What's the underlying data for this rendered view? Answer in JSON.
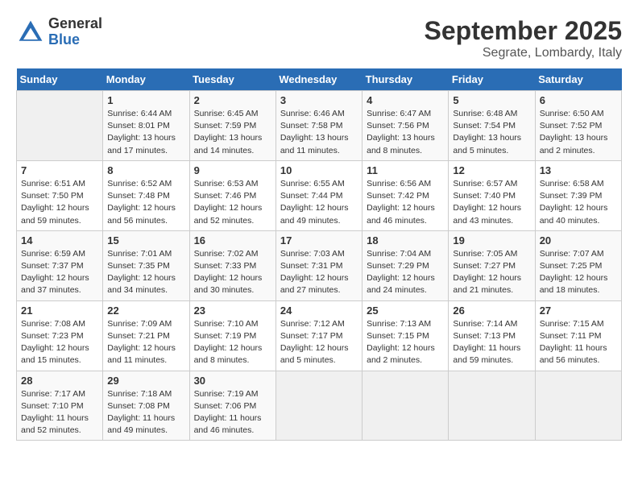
{
  "header": {
    "logo_general": "General",
    "logo_blue": "Blue",
    "title": "September 2025",
    "subtitle": "Segrate, Lombardy, Italy"
  },
  "days_of_week": [
    "Sunday",
    "Monday",
    "Tuesday",
    "Wednesday",
    "Thursday",
    "Friday",
    "Saturday"
  ],
  "weeks": [
    [
      {
        "day": "",
        "info": ""
      },
      {
        "day": "1",
        "info": "Sunrise: 6:44 AM\nSunset: 8:01 PM\nDaylight: 13 hours\nand 17 minutes."
      },
      {
        "day": "2",
        "info": "Sunrise: 6:45 AM\nSunset: 7:59 PM\nDaylight: 13 hours\nand 14 minutes."
      },
      {
        "day": "3",
        "info": "Sunrise: 6:46 AM\nSunset: 7:58 PM\nDaylight: 13 hours\nand 11 minutes."
      },
      {
        "day": "4",
        "info": "Sunrise: 6:47 AM\nSunset: 7:56 PM\nDaylight: 13 hours\nand 8 minutes."
      },
      {
        "day": "5",
        "info": "Sunrise: 6:48 AM\nSunset: 7:54 PM\nDaylight: 13 hours\nand 5 minutes."
      },
      {
        "day": "6",
        "info": "Sunrise: 6:50 AM\nSunset: 7:52 PM\nDaylight: 13 hours\nand 2 minutes."
      }
    ],
    [
      {
        "day": "7",
        "info": "Sunrise: 6:51 AM\nSunset: 7:50 PM\nDaylight: 12 hours\nand 59 minutes."
      },
      {
        "day": "8",
        "info": "Sunrise: 6:52 AM\nSunset: 7:48 PM\nDaylight: 12 hours\nand 56 minutes."
      },
      {
        "day": "9",
        "info": "Sunrise: 6:53 AM\nSunset: 7:46 PM\nDaylight: 12 hours\nand 52 minutes."
      },
      {
        "day": "10",
        "info": "Sunrise: 6:55 AM\nSunset: 7:44 PM\nDaylight: 12 hours\nand 49 minutes."
      },
      {
        "day": "11",
        "info": "Sunrise: 6:56 AM\nSunset: 7:42 PM\nDaylight: 12 hours\nand 46 minutes."
      },
      {
        "day": "12",
        "info": "Sunrise: 6:57 AM\nSunset: 7:40 PM\nDaylight: 12 hours\nand 43 minutes."
      },
      {
        "day": "13",
        "info": "Sunrise: 6:58 AM\nSunset: 7:39 PM\nDaylight: 12 hours\nand 40 minutes."
      }
    ],
    [
      {
        "day": "14",
        "info": "Sunrise: 6:59 AM\nSunset: 7:37 PM\nDaylight: 12 hours\nand 37 minutes."
      },
      {
        "day": "15",
        "info": "Sunrise: 7:01 AM\nSunset: 7:35 PM\nDaylight: 12 hours\nand 34 minutes."
      },
      {
        "day": "16",
        "info": "Sunrise: 7:02 AM\nSunset: 7:33 PM\nDaylight: 12 hours\nand 30 minutes."
      },
      {
        "day": "17",
        "info": "Sunrise: 7:03 AM\nSunset: 7:31 PM\nDaylight: 12 hours\nand 27 minutes."
      },
      {
        "day": "18",
        "info": "Sunrise: 7:04 AM\nSunset: 7:29 PM\nDaylight: 12 hours\nand 24 minutes."
      },
      {
        "day": "19",
        "info": "Sunrise: 7:05 AM\nSunset: 7:27 PM\nDaylight: 12 hours\nand 21 minutes."
      },
      {
        "day": "20",
        "info": "Sunrise: 7:07 AM\nSunset: 7:25 PM\nDaylight: 12 hours\nand 18 minutes."
      }
    ],
    [
      {
        "day": "21",
        "info": "Sunrise: 7:08 AM\nSunset: 7:23 PM\nDaylight: 12 hours\nand 15 minutes."
      },
      {
        "day": "22",
        "info": "Sunrise: 7:09 AM\nSunset: 7:21 PM\nDaylight: 12 hours\nand 11 minutes."
      },
      {
        "day": "23",
        "info": "Sunrise: 7:10 AM\nSunset: 7:19 PM\nDaylight: 12 hours\nand 8 minutes."
      },
      {
        "day": "24",
        "info": "Sunrise: 7:12 AM\nSunset: 7:17 PM\nDaylight: 12 hours\nand 5 minutes."
      },
      {
        "day": "25",
        "info": "Sunrise: 7:13 AM\nSunset: 7:15 PM\nDaylight: 12 hours\nand 2 minutes."
      },
      {
        "day": "26",
        "info": "Sunrise: 7:14 AM\nSunset: 7:13 PM\nDaylight: 11 hours\nand 59 minutes."
      },
      {
        "day": "27",
        "info": "Sunrise: 7:15 AM\nSunset: 7:11 PM\nDaylight: 11 hours\nand 56 minutes."
      }
    ],
    [
      {
        "day": "28",
        "info": "Sunrise: 7:17 AM\nSunset: 7:10 PM\nDaylight: 11 hours\nand 52 minutes."
      },
      {
        "day": "29",
        "info": "Sunrise: 7:18 AM\nSunset: 7:08 PM\nDaylight: 11 hours\nand 49 minutes."
      },
      {
        "day": "30",
        "info": "Sunrise: 7:19 AM\nSunset: 7:06 PM\nDaylight: 11 hours\nand 46 minutes."
      },
      {
        "day": "",
        "info": ""
      },
      {
        "day": "",
        "info": ""
      },
      {
        "day": "",
        "info": ""
      },
      {
        "day": "",
        "info": ""
      }
    ]
  ]
}
